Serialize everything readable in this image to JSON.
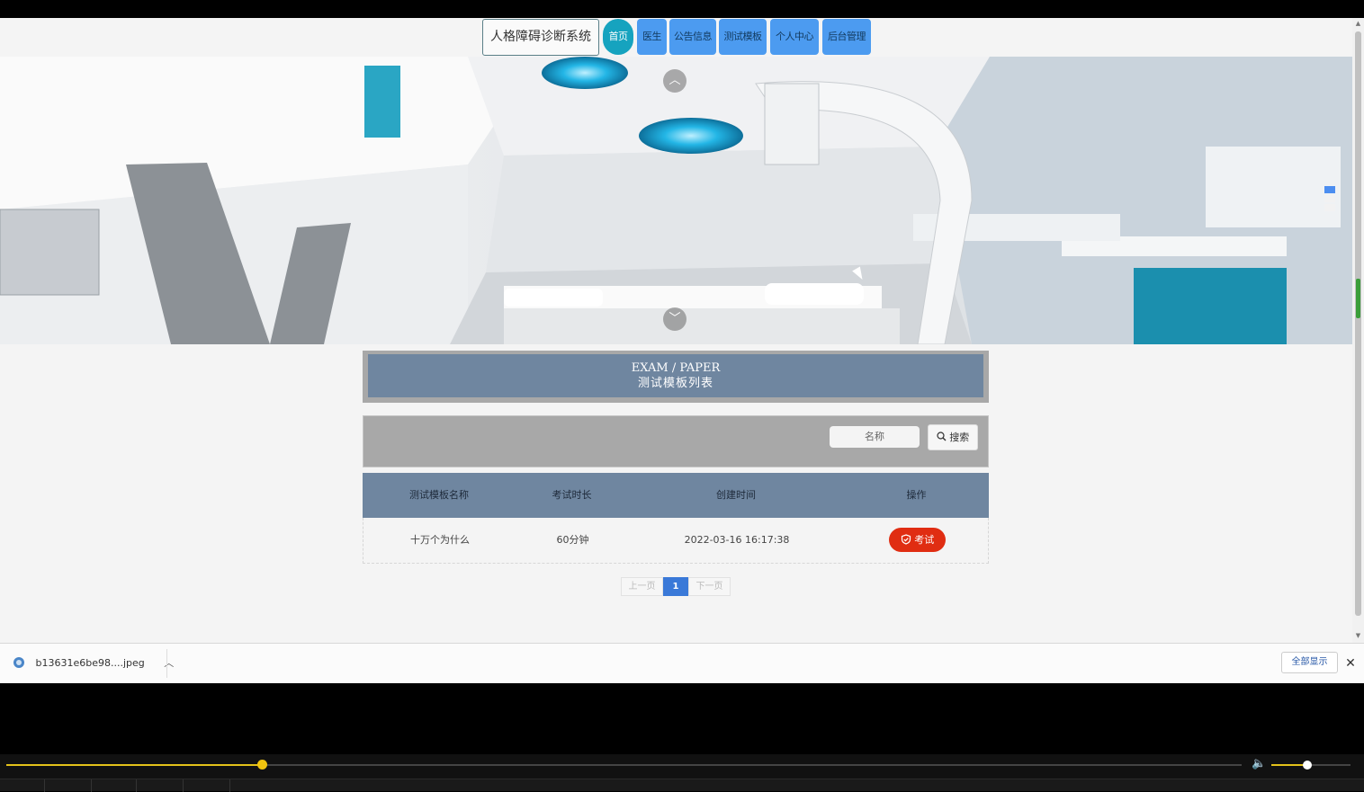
{
  "navbar": {
    "brand": "人格障碍诊断系统",
    "items": [
      "首页",
      "医生",
      "公告信息",
      "测试模板",
      "个人中心",
      "后台管理"
    ]
  },
  "banner": {
    "up_icon": "chevron-up-icon",
    "down_icon": "chevron-down-icon"
  },
  "section": {
    "title_en": "EXAM / PAPER",
    "title_zh": "测试模板列表"
  },
  "search": {
    "placeholder": "名称",
    "button_label": "搜索",
    "button_icon": "search-icon"
  },
  "table": {
    "columns": [
      "测试模板名称",
      "考试时长",
      "创建时间",
      "操作"
    ],
    "rows": [
      {
        "name": "十万个为什么",
        "duration": "60分钟",
        "created": "2022-03-16 16:17:38",
        "action": "考试"
      }
    ]
  },
  "pager": {
    "prev": "上一页",
    "current": "1",
    "next": "下一页"
  },
  "download_bar": {
    "file_name": "b13631e6be98....jpeg",
    "show_all": "全部显示",
    "close": "✕"
  },
  "player": {
    "progress": 0.207,
    "volume": 0.45
  },
  "colors": {
    "accent_home": "#16a3bf",
    "nav_blue": "#4c9bf0",
    "header_slate": "#6f86a0",
    "exam_red": "#e02d12",
    "pager_blue": "#3a79d8",
    "player_yellow": "#f1c40f"
  }
}
